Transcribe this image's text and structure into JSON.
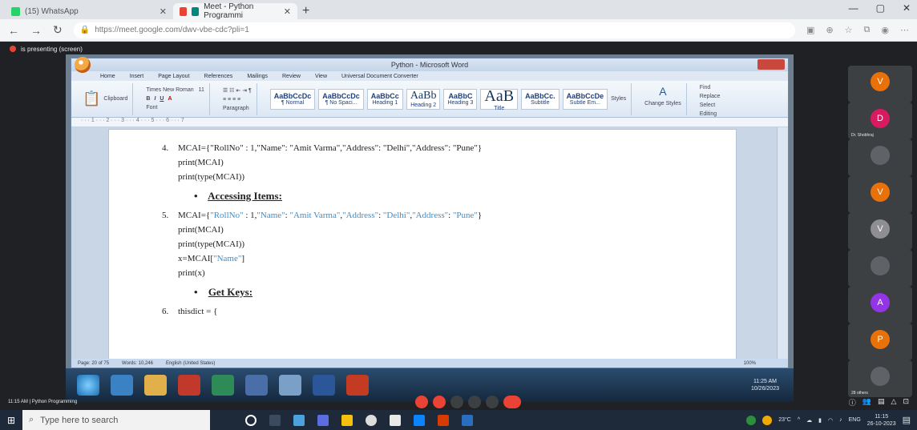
{
  "browser": {
    "tabs": [
      {
        "label": "(15) WhatsApp",
        "active": false
      },
      {
        "label": "Meet - Python Programmi",
        "active": true
      }
    ],
    "new_tab": "+",
    "url": "https://meet.google.com/dwv-vbe-cdc?pli=1",
    "window_controls": [
      "—",
      "▢",
      "✕"
    ]
  },
  "meet": {
    "header": "is presenting (screen)",
    "meeting_name": "11:15 AM | Python Programming",
    "participants": [
      {
        "initial": "V",
        "color": "#e8710a",
        "name": ""
      },
      {
        "initial": "D",
        "color": "#d81b60",
        "name": "Dr. Shobhraj"
      },
      {
        "initial": "",
        "color": "#5f6368",
        "name": ""
      },
      {
        "initial": "V",
        "color": "#e8710a",
        "name": ""
      },
      {
        "initial": "V",
        "color": "#8e8e93",
        "name": ""
      },
      {
        "initial": "",
        "color": "#5f6368",
        "name": ""
      },
      {
        "initial": "A",
        "color": "#9334e6",
        "name": ""
      },
      {
        "initial": "P",
        "color": "#e8710a",
        "name": ""
      },
      {
        "initial": "",
        "color": "#5f6368",
        "name": "28 others"
      }
    ]
  },
  "word": {
    "title": "Python - Microsoft Word",
    "tabs": [
      "Home",
      "Insert",
      "Page Layout",
      "References",
      "Mailings",
      "Review",
      "View",
      "Universal Document Converter"
    ],
    "font_name": "Times New Roman",
    "font_size": "11",
    "styles": [
      {
        "sample": "AaBbCcDc",
        "name": "¶ Normal",
        "cls": ""
      },
      {
        "sample": "AaBbCcDc",
        "name": "¶ No Spaci...",
        "cls": ""
      },
      {
        "sample": "AaBbCc",
        "name": "Heading 1",
        "cls": ""
      },
      {
        "sample": "AaBb",
        "name": "Heading 2",
        "cls": "big"
      },
      {
        "sample": "AaBbC",
        "name": "Heading 3",
        "cls": ""
      },
      {
        "sample": "AaB",
        "name": "Title",
        "cls": "huge"
      },
      {
        "sample": "AaBbCc.",
        "name": "Subtitle",
        "cls": ""
      },
      {
        "sample": "AaBbCcDe",
        "name": "Subtle Em...",
        "cls": ""
      }
    ],
    "groups": {
      "clipboard": "Clipboard",
      "font": "Font",
      "paragraph": "Paragraph",
      "styles": "Styles",
      "editing": "Editing",
      "change_styles": "Change Styles",
      "find": "Find",
      "replace": "Replace",
      "select": "Select"
    },
    "status": {
      "page": "Page: 20 of 75",
      "words": "Words: 10,246",
      "language": "English (United States)",
      "zoom": "100%"
    },
    "doc": {
      "item4_num": "4.",
      "item4_code": "MCAI={\"RollNo\" : 1,\"Name\": \"Amit Varma\",\"Address\": \"Delhi\",\"Address\": \"Pune\"}",
      "item4_l2": "print(MCAI)",
      "item4_l3": "print(type(MCAI))",
      "h1": "Accessing Items:",
      "item5_num": "5.",
      "item5_a": "MCAI={",
      "item5_b": "\"RollNo\"",
      "item5_c": " : 1,",
      "item5_d": "\"Name\"",
      "item5_e": ": ",
      "item5_f": "\"Amit Varma\"",
      "item5_g": ",",
      "item5_h": "\"Address\"",
      "item5_i": ": ",
      "item5_j": "\"Delhi\"",
      "item5_k": ",",
      "item5_l": "\"Address\"",
      "item5_m": ": ",
      "item5_n": "\"Pune\"",
      "item5_o": "}",
      "item5_l2": "print(MCAI)",
      "item5_l3": "print(type(MCAI))",
      "item5_l4a": "x=MCAI[",
      "item5_l4b": "\"Name\"",
      "item5_l4c": "]",
      "item5_l5": "print(x)",
      "h2": "Get Keys:",
      "item6_num": "6.",
      "item6_code": "thisdict = {"
    }
  },
  "win7": {
    "time": "11:25 AM",
    "date": "10/26/2023"
  },
  "taskbar": {
    "search_placeholder": "Type here to search",
    "temperature": "23°C",
    "lang": "ENG",
    "time": "11:15",
    "date": "26-10-2023"
  }
}
